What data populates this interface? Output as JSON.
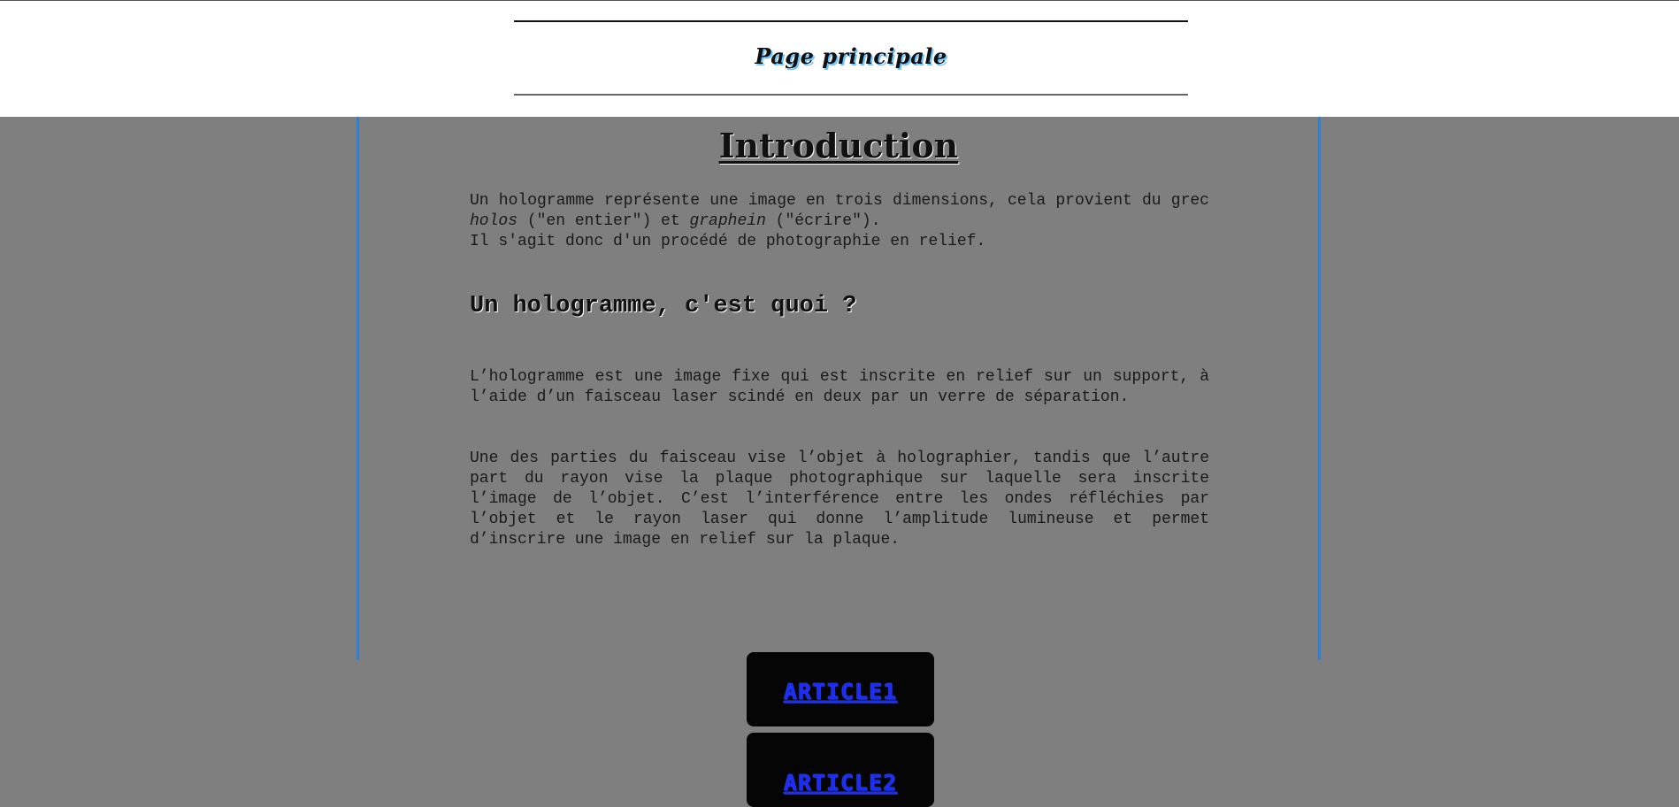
{
  "header": {
    "title": "Page principale"
  },
  "main": {
    "title": "Introduction",
    "intro": {
      "text_1": "Un hologramme représente une image en trois dimensions, cela provient du grec ",
      "word_holos": "holos",
      "text_2": " (\"en entier\") et ",
      "word_graphein": "graphein",
      "text_3": " (\"écrire\").",
      "line_2": "Il s'agit donc d'un procédé de photographie en relief."
    },
    "section_heading": "Un hologramme, c'est quoi ?",
    "paragraph_2": "L’hologramme est une image fixe qui est inscrite en relief sur un support, à l’aide d’un faisceau laser scindé en deux par un verre de séparation.",
    "paragraph_3": "Une des parties du faisceau vise l’objet à holographier, tandis que l’autre part du rayon vise la plaque photographique sur laquelle sera inscrite l’image de l’objet. C’est l’interférence entre les ondes réfléchies par l’objet et le rayon laser qui donne l’amplitude lumineuse et permet d’inscrire une image en relief sur la plaque."
  },
  "nav": {
    "buttons": [
      {
        "label": "ARTICLE1"
      },
      {
        "label": "ARTICLE2"
      }
    ]
  },
  "colors": {
    "page_background": "#7f7f7f",
    "header_background": "#ffffff",
    "frame_border": "#2f7fd4",
    "button_background": "#050505",
    "button_text": "#1a2bff",
    "title_shadow": "#6ec6ff"
  }
}
